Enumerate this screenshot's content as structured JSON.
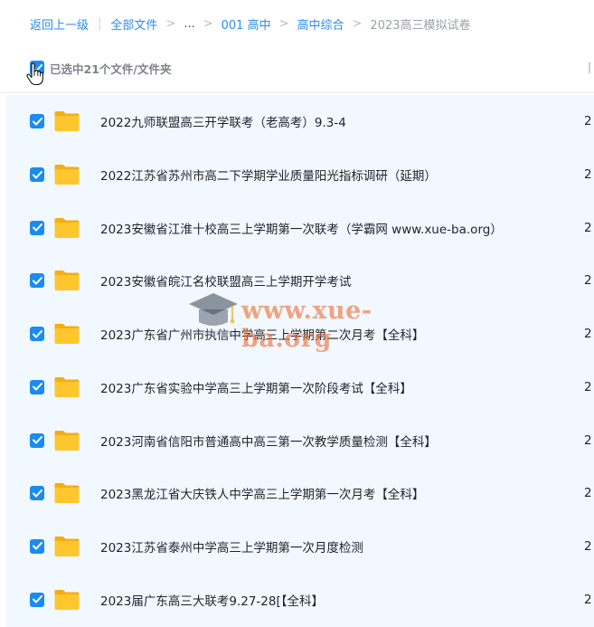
{
  "breadcrumb": {
    "back": "返回上一级",
    "all_files": "全部文件",
    "ellipsis": "...",
    "level1": "001 高中",
    "level2": "高中综合",
    "current": "2023高三模拟试卷"
  },
  "selection": {
    "summary": "已选中21个文件/文件夹"
  },
  "files": [
    {
      "name": "2022九师联盟高三开学联考（老高考）9.3-4",
      "date": "2"
    },
    {
      "name": "2022江苏省苏州市高二下学期学业质量阳光指标调研（延期）",
      "date": "2"
    },
    {
      "name": "2023安徽省江淮十校高三上学期第一次联考（学霸网 www.xue-ba.org）",
      "date": "2"
    },
    {
      "name": "2023安徽省皖江名校联盟高三上学期开学考试",
      "date": "2"
    },
    {
      "name": "2023广东省广州市执信中学高三上学期第二次月考【全科】",
      "date": "2"
    },
    {
      "name": "2023广东省实验中学高三上学期第一次阶段考试【全科】",
      "date": "2"
    },
    {
      "name": "2023河南省信阳市普通高中高三第一次教学质量检测【全科】",
      "date": "2"
    },
    {
      "name": "2023黑龙江省大庆铁人中学高三上学期第一次月考【全科】",
      "date": "2"
    },
    {
      "name": "2023江苏省泰州中学高三上学期第一次月度检测",
      "date": "2"
    },
    {
      "name": "2023届广东高三大联考9.27-28[【全科】",
      "date": "2"
    }
  ],
  "watermark": {
    "text": "www.xue-ba.org"
  },
  "colors": {
    "accent": "#1a8cf0",
    "link": "#2a8cf0",
    "row_bg": "#f2f8ff",
    "folder": "#ffc62e",
    "watermark": "#ec7036"
  },
  "icons": [
    "checkbox-checked-icon",
    "folder-icon",
    "pointer-cursor-icon",
    "graduation-cap-icon"
  ]
}
